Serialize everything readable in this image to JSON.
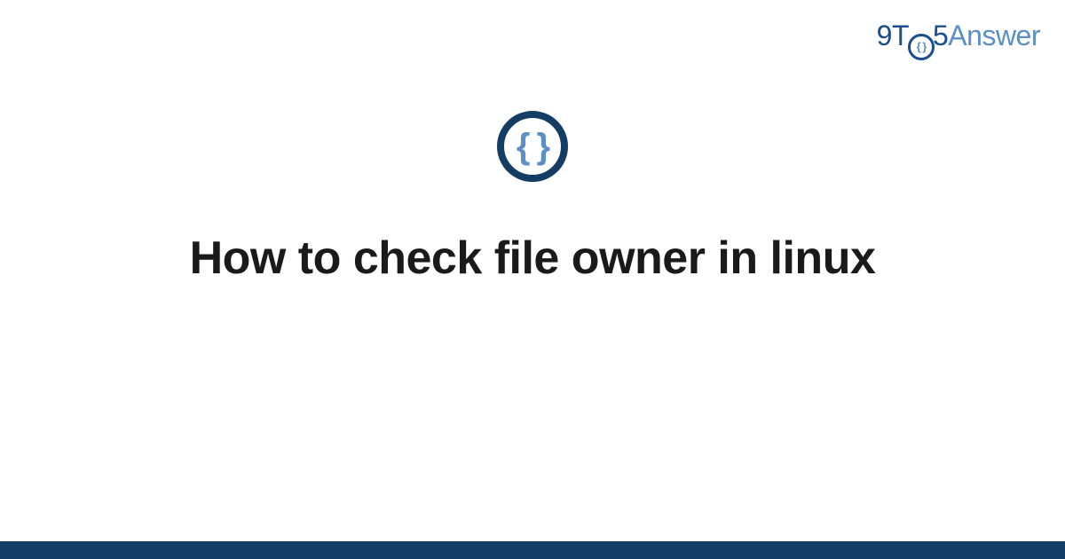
{
  "brand": {
    "nine": "9",
    "t": "T",
    "five": "5",
    "answer": "Answer",
    "icon_glyph": "{ }"
  },
  "logo": {
    "icon_glyph": "{ }"
  },
  "title": "How to check file owner in linux",
  "colors": {
    "brand_dark": "#1a4f8f",
    "brand_light": "#5a8fc7",
    "logo_ring": "#143d66",
    "footer": "#143d66",
    "text": "#1a1a1a"
  }
}
